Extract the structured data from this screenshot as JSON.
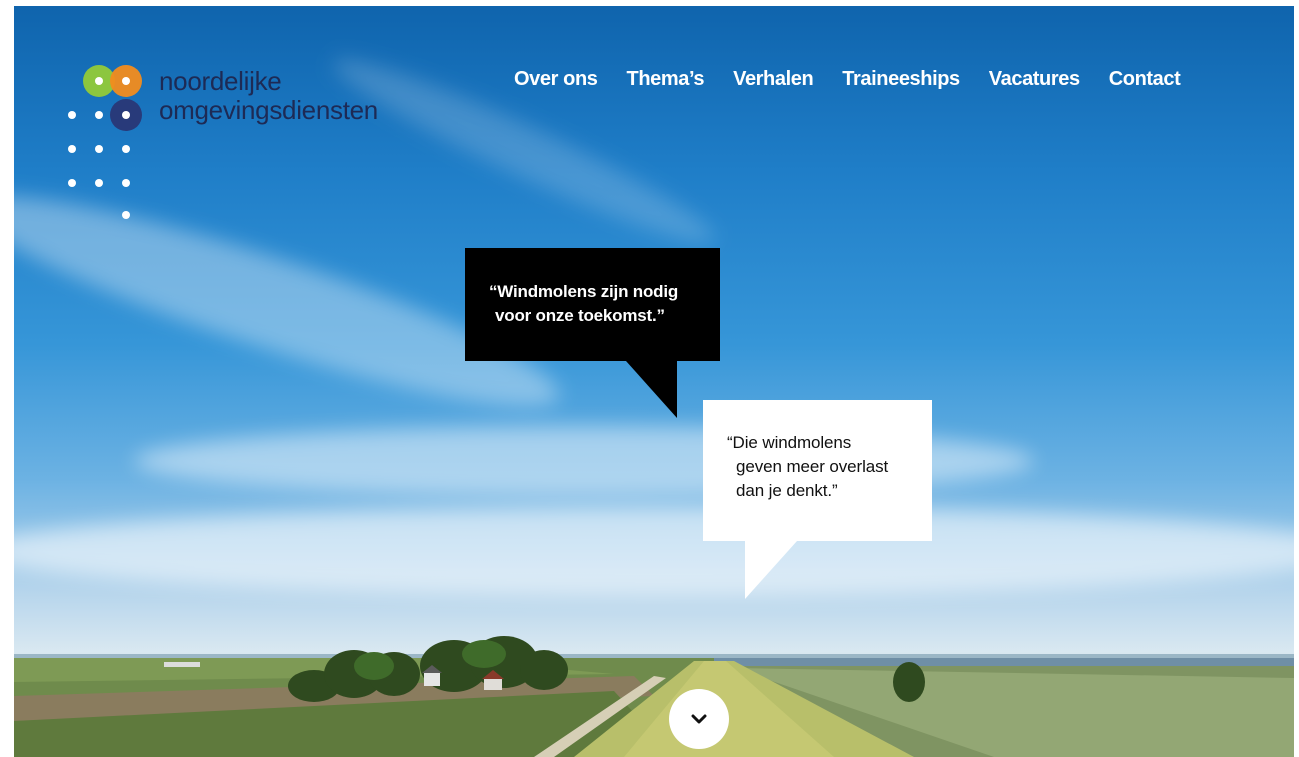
{
  "brand": {
    "line1": "noordelijke",
    "line2": "omgevingsdiensten",
    "colors": {
      "green": "#8cc63f",
      "orange": "#f28c1e",
      "navy": "#283a7a",
      "text": "#1d2a55"
    }
  },
  "nav": {
    "items": [
      "Over ons",
      "Thema’s",
      "Verhalen",
      "Traineeships",
      "Vacatures",
      "Contact"
    ]
  },
  "hero": {
    "quote_black": {
      "line1": "“Windmolens zijn nodig",
      "line2": "voor onze toekomst.”"
    },
    "quote_white": {
      "line1": "“Die windmolens",
      "line2": "geven meer overlast",
      "line3": "dan je denkt.”"
    },
    "scroll_icon": "chevron-down-icon"
  }
}
